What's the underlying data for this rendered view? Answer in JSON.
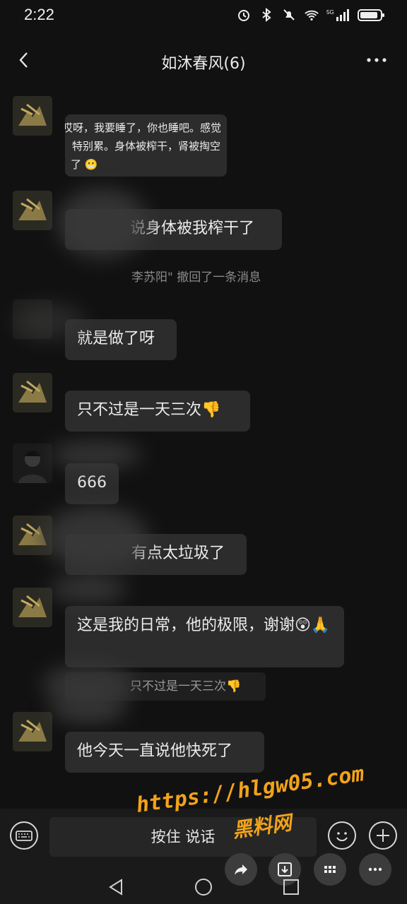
{
  "status": {
    "time": "2:22",
    "network": "5G"
  },
  "header": {
    "title": "如沐春风(6)"
  },
  "messages": [
    {
      "lines": [
        "哎呀，我要睡了，你也睡吧。感觉",
        "特别累。身体被榨干，肾被掏空",
        "了"
      ]
    },
    {
      "text": "说身体被我榨干了"
    },
    {
      "text": "就是做了呀"
    },
    {
      "text": "只不过是一天三次👎"
    },
    {
      "text": "666"
    },
    {
      "text": "有点太垃圾了"
    },
    {
      "text": "这是我的日常，他的极限，谢谢😲🙏"
    },
    {
      "text": "他今天一直说他快死了"
    }
  ],
  "recall_notice": "李苏阳\" 撤回了一条消息",
  "quote": "只不过是一天三次👎",
  "input": {
    "voice_label": "按住 说话"
  },
  "watermark": {
    "url": "https://hlgw05.com",
    "name": "黑料网"
  },
  "colors": {
    "background": "#111111",
    "bubble": "#2c2c2c",
    "watermark": "#f2a31a"
  }
}
